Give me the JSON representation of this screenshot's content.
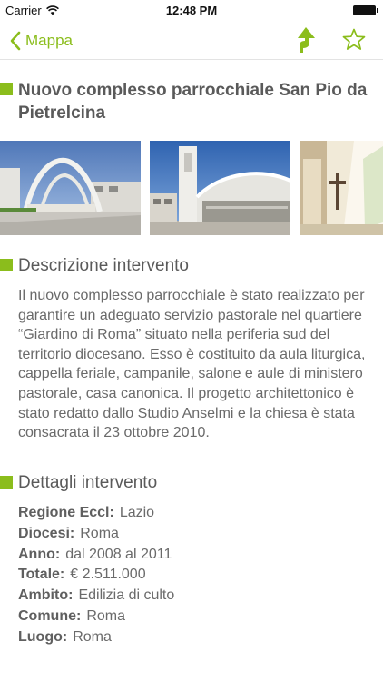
{
  "status": {
    "carrier": "Carrier",
    "time": "12:48 PM"
  },
  "nav": {
    "back_label": "Mappa"
  },
  "page": {
    "title": "Nuovo complesso parrocchiale San Pio da Pietrelcina"
  },
  "description": {
    "heading": "Descrizione intervento",
    "text": "Il nuovo complesso parrocchiale è stato realizzato per garantire un adeguato servizio pastorale nel quartiere “Giardino di Roma” situato nella periferia sud del territorio diocesano. Esso è costituito da aula liturgica, cappella feriale, campanile, salone e aule di ministero pastorale, casa canonica. Il progetto architettonico è stato redatto dallo Studio Anselmi e la chiesa è stata consacrata il 23 ottobre 2010."
  },
  "details": {
    "heading": "Dettagli intervento",
    "rows": [
      {
        "label": "Regione Eccl:",
        "value": "Lazio"
      },
      {
        "label": "Diocesi:",
        "value": "Roma"
      },
      {
        "label": "Anno:",
        "value": "dal 2008 al 2011"
      },
      {
        "label": "Totale:",
        "value": "€ 2.511.000"
      },
      {
        "label": "Ambito:",
        "value": "Edilizia di culto"
      },
      {
        "label": "Comune:",
        "value": "Roma"
      },
      {
        "label": "Luogo:",
        "value": "Roma"
      }
    ]
  },
  "colors": {
    "accent": "#8bbd1c",
    "text": "#6a6a6a"
  },
  "icons": {
    "back": "chevron-left-icon",
    "share": "share-directions-icon",
    "favorite": "star-outline-icon"
  }
}
